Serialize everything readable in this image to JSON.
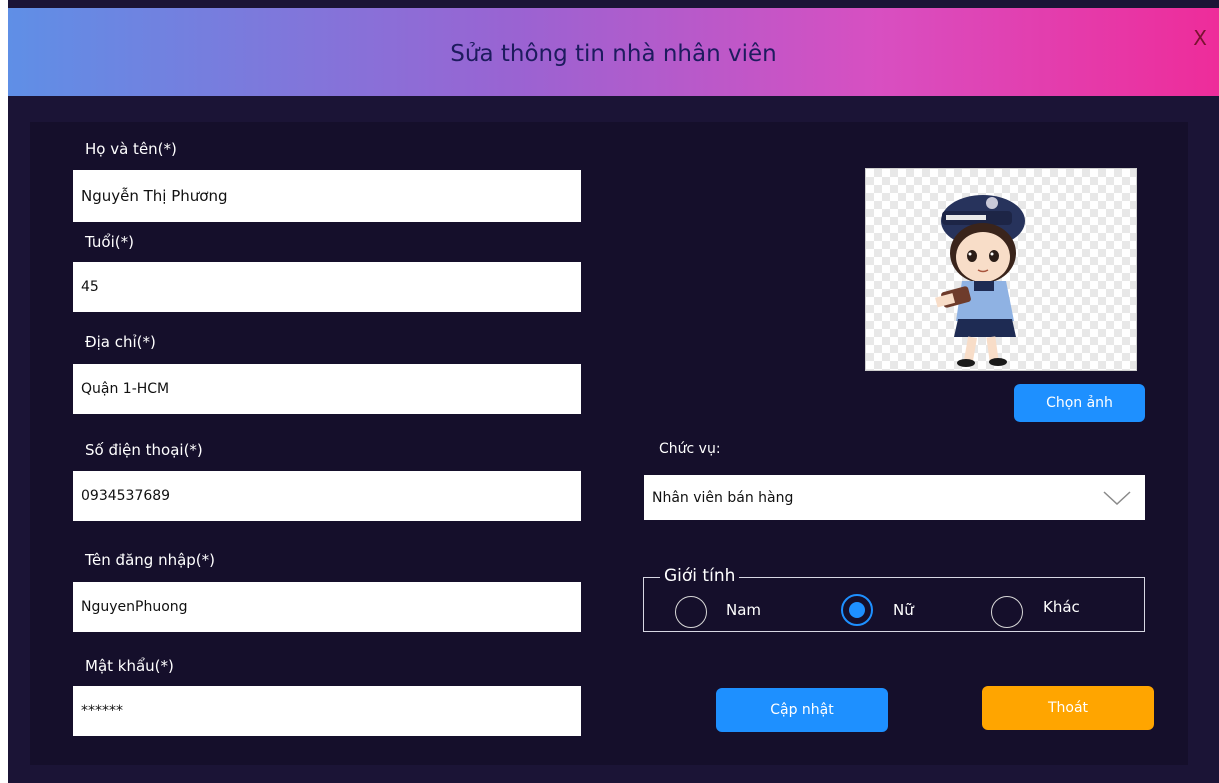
{
  "window": {
    "title": "Sửa thông tin nhà nhân viên",
    "close_label": "X"
  },
  "form": {
    "name": {
      "label": "Họ và tên(*)",
      "value": "Nguyễn Thị Phương"
    },
    "age": {
      "label": "Tuổi(*)",
      "value": "45"
    },
    "address": {
      "label": "Địa chỉ(*)",
      "value": "Quận 1-HCM"
    },
    "phone": {
      "label": "Số điện thoại(*)",
      "value": "0934537689"
    },
    "username": {
      "label": "Tên đăng nhập(*)",
      "value": "NguyenPhuong"
    },
    "password": {
      "label": "Mật khẩu(*)",
      "value": "******"
    }
  },
  "photo": {
    "choose_label": "Chọn ảnh",
    "icon": "police-girl-avatar"
  },
  "position": {
    "label": "Chức vụ:",
    "selected": "Nhân viên bán hàng"
  },
  "gender": {
    "legend": "Giới tính",
    "options": [
      "Nam",
      "Nữ",
      "Khác"
    ],
    "selected": "Nữ"
  },
  "buttons": {
    "update_label": "Cập nhật",
    "exit_label": "Thoát"
  },
  "colors": {
    "background": "#1b1436",
    "panel": "#150f2b",
    "button_blue": "#1e90ff",
    "button_orange": "#ffa500"
  }
}
